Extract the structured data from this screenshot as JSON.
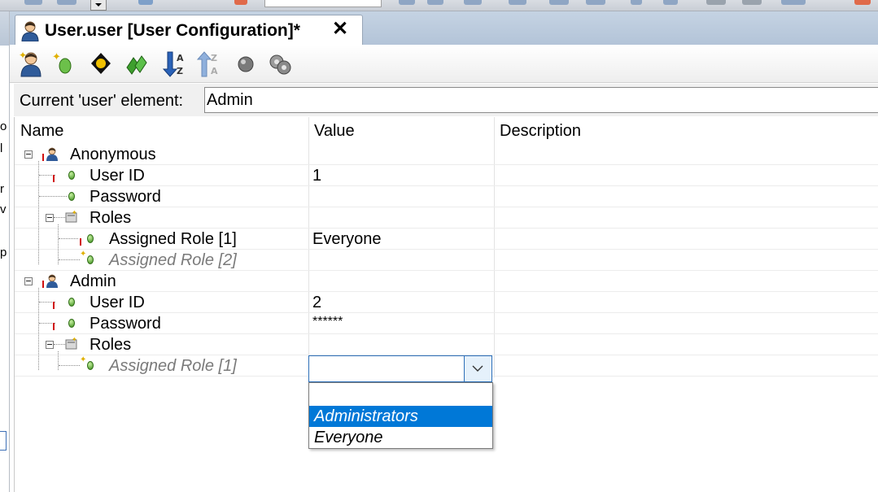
{
  "editor_tab": {
    "title": "User.user [User Configuration]*",
    "close_glyph": "✕"
  },
  "toolbar": {
    "buttons": [
      {
        "name": "add-user-icon"
      },
      {
        "name": "add-element-icon"
      },
      {
        "name": "navigate-icon"
      },
      {
        "name": "cards-icon"
      },
      {
        "name": "sort-ascending-icon"
      },
      {
        "name": "sort-descending-icon"
      },
      {
        "name": "sphere-icon"
      },
      {
        "name": "gears-icon"
      }
    ]
  },
  "current_element": {
    "label": "Current 'user' element:",
    "value": "Admin"
  },
  "table": {
    "columns": [
      "Name",
      "Value",
      "Description"
    ],
    "rows": [
      {
        "name": "Anonymous",
        "value": "",
        "type": "user"
      },
      {
        "name": "User ID",
        "value": "1",
        "type": "attr"
      },
      {
        "name": "Password",
        "value": "",
        "type": "attr"
      },
      {
        "name": "Roles",
        "value": "",
        "type": "group"
      },
      {
        "name": "Assigned Role [1]",
        "value": "Everyone",
        "type": "attr"
      },
      {
        "name": "Assigned Role [2]",
        "value": "",
        "type": "placeholder"
      },
      {
        "name": "Admin",
        "value": "",
        "type": "user"
      },
      {
        "name": "User ID",
        "value": "2",
        "type": "attr"
      },
      {
        "name": "Password",
        "value": "******",
        "type": "attr"
      },
      {
        "name": "Roles",
        "value": "",
        "type": "group"
      },
      {
        "name": "Assigned Role [1]",
        "value": "",
        "type": "placeholder"
      }
    ]
  },
  "role_dropdown": {
    "selected_value": "",
    "options": [
      "",
      "Administrators",
      "Everyone"
    ],
    "highlighted": "Administrators"
  },
  "left_panel_fragments": [
    "o",
    "l",
    "r",
    "v",
    "p"
  ],
  "colors": {
    "selection": "#0078d7",
    "tab_bar": "#b3c4d8",
    "combo_border": "#2d6fb8"
  }
}
